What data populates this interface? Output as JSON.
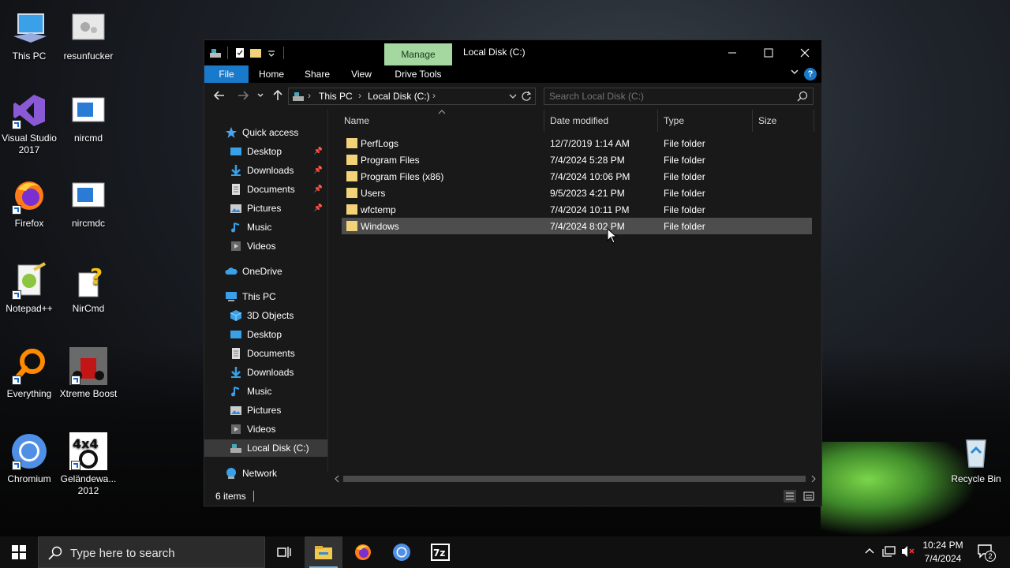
{
  "desktop": {
    "icons": [
      {
        "label": "This PC"
      },
      {
        "label": "resunfucker"
      },
      {
        "label": "Visual Studio 2017"
      },
      {
        "label": "nircmd"
      },
      {
        "label": "Firefox"
      },
      {
        "label": "nircmdc"
      },
      {
        "label": "Notepad++"
      },
      {
        "label": "NirCmd"
      },
      {
        "label": "Everything"
      },
      {
        "label": "Xtreme Boost"
      },
      {
        "label": "Chromium"
      },
      {
        "label": "Geländewa... 2012"
      },
      {
        "label": "Recycle Bin"
      }
    ]
  },
  "window": {
    "title": "Local Disk (C:)",
    "contextual_tab": "Manage",
    "ribbon_tabs": [
      "File",
      "Home",
      "Share",
      "View",
      "Drive Tools"
    ],
    "help_glyph": "?",
    "breadcrumb": [
      "This PC",
      "Local Disk (C:)"
    ],
    "search_placeholder": "Search Local Disk (C:)",
    "nav": {
      "quick_access": "Quick access",
      "quick_items": [
        "Desktop",
        "Downloads",
        "Documents",
        "Pictures",
        "Music",
        "Videos"
      ],
      "onedrive": "OneDrive",
      "this_pc": "This PC",
      "pc_items": [
        "3D Objects",
        "Desktop",
        "Documents",
        "Downloads",
        "Music",
        "Pictures",
        "Videos",
        "Local Disk (C:)"
      ],
      "network": "Network"
    },
    "columns": [
      "Name",
      "Date modified",
      "Type",
      "Size"
    ],
    "files": [
      {
        "name": "PerfLogs",
        "date": "12/7/2019 1:14 AM",
        "type": "File folder",
        "size": ""
      },
      {
        "name": "Program Files",
        "date": "7/4/2024 5:28 PM",
        "type": "File folder",
        "size": ""
      },
      {
        "name": "Program Files (x86)",
        "date": "7/4/2024 10:06 PM",
        "type": "File folder",
        "size": ""
      },
      {
        "name": "Users",
        "date": "9/5/2023 4:21 PM",
        "type": "File folder",
        "size": ""
      },
      {
        "name": "wfctemp",
        "date": "7/4/2024 10:11 PM",
        "type": "File folder",
        "size": ""
      },
      {
        "name": "Windows",
        "date": "7/4/2024 8:02 PM",
        "type": "File folder",
        "size": ""
      }
    ],
    "selected_file": "Windows",
    "status": "6 items"
  },
  "taskbar": {
    "search_placeholder": "Type here to search",
    "time": "10:24 PM",
    "date": "7/4/2024",
    "notification_count": "2"
  },
  "colors": {
    "accent": "#1979ca",
    "manage_tab": "#a5d8a0",
    "folder": "#f3d37a",
    "window_bg": "#191919"
  }
}
